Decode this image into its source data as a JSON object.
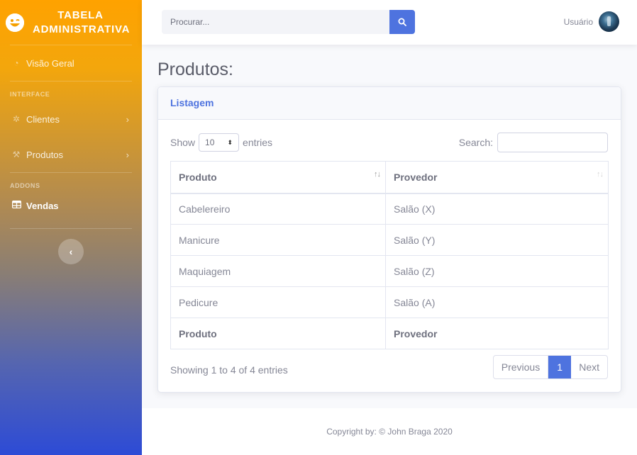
{
  "brand": {
    "line1": "TABELA",
    "line2": "ADMINISTRATIVA"
  },
  "sidebar": {
    "overview": "Visão Geral",
    "heading_interface": "INTERFACE",
    "clientes": "Clientes",
    "produtos": "Produtos",
    "heading_addons": "ADDONS",
    "vendas": "Vendas",
    "toggle": "‹"
  },
  "topbar": {
    "search_placeholder": "Procurar...",
    "user_name": "Usuário"
  },
  "page": {
    "title": "Produtos:"
  },
  "card": {
    "header": "Listagem"
  },
  "datatable": {
    "show_label": "Show",
    "length_value": "10",
    "entries_label": "entries",
    "search_label": "Search:",
    "columns": [
      "Produto",
      "Provedor"
    ],
    "rows": [
      [
        "Cabelereiro",
        "Salão (X)"
      ],
      [
        "Manicure",
        "Salão (Y)"
      ],
      [
        "Maquiagem",
        "Salão (Z)"
      ],
      [
        "Pedicure",
        "Salão (A)"
      ]
    ],
    "footer_columns": [
      "Produto",
      "Provedor"
    ],
    "info": "Showing 1 to 4 of 4 entries",
    "pagination": {
      "previous": "Previous",
      "current": "1",
      "next": "Next"
    }
  },
  "footer": {
    "copyright": "Copyright by: © John Braga 2020"
  },
  "colors": {
    "accent": "#4e73df",
    "sidebar_top": "#ffa200",
    "sidebar_bottom": "#2d4bd6"
  }
}
